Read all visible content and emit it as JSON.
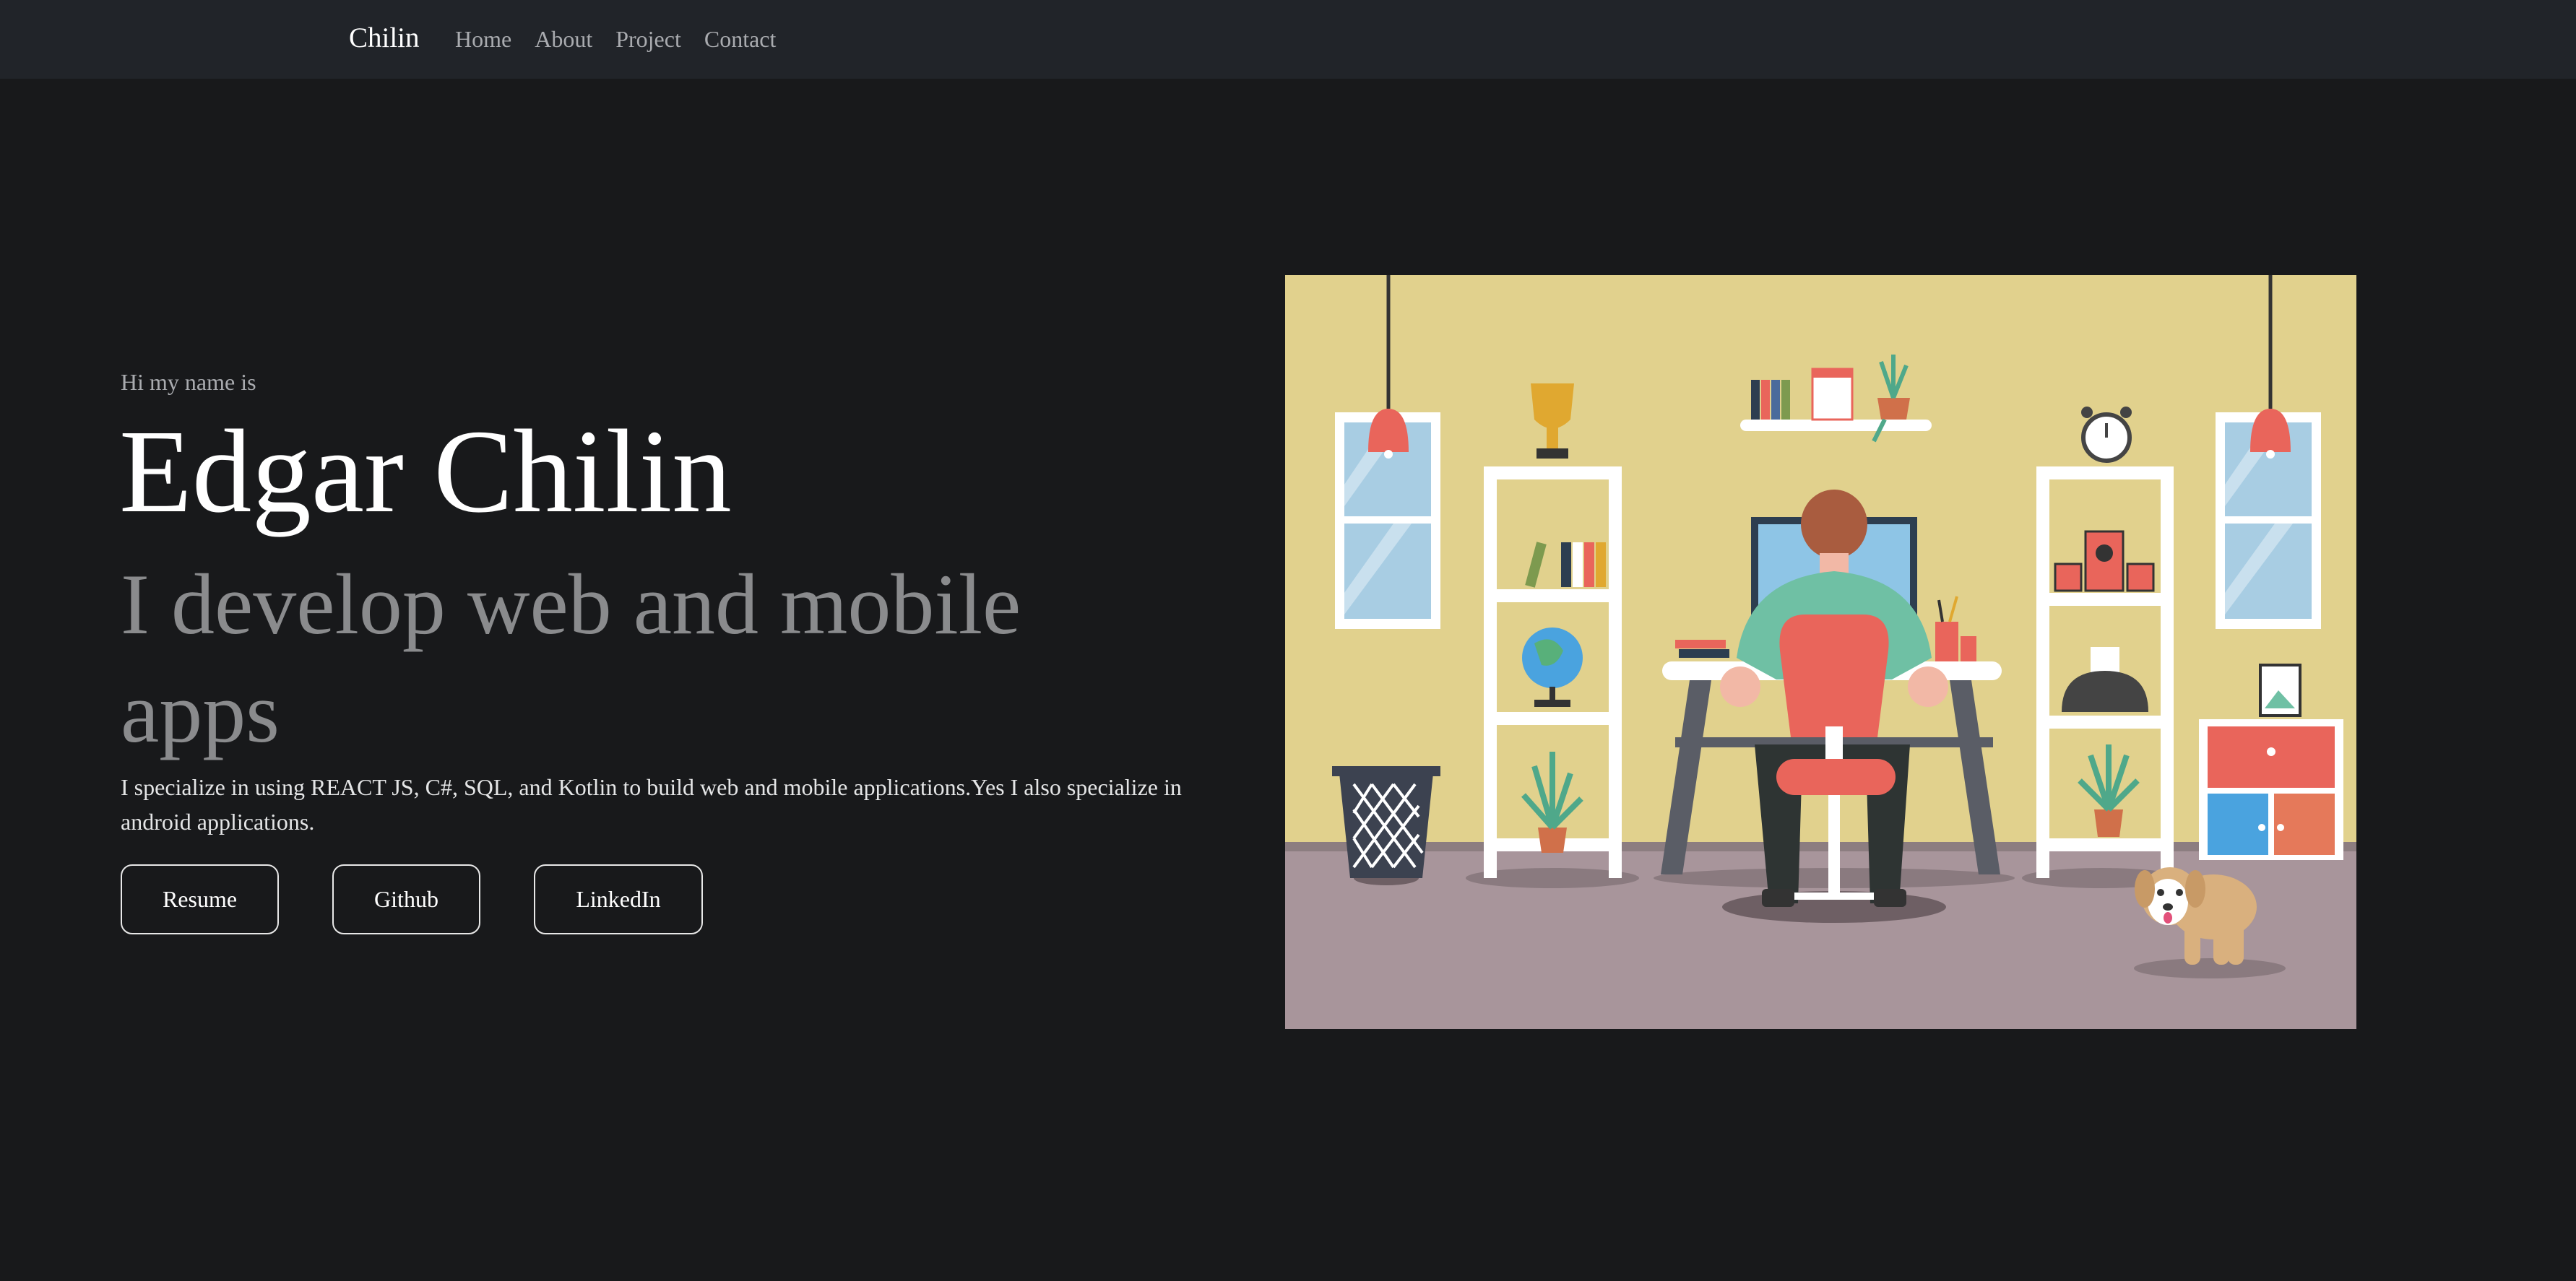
{
  "nav": {
    "brand": "Chilin",
    "links": [
      "Home",
      "About",
      "Project",
      "Contact"
    ]
  },
  "hero": {
    "greeting": "Hi my name is",
    "name": "Edgar Chilin",
    "tagline": "I develop web and mobile apps",
    "description": "I specialize in using REACT JS, C#, SQL, and Kotlin to build web and mobile applications.Yes I also specialize in android applications.",
    "buttons": {
      "resume": "Resume",
      "github": "Github",
      "linkedin": "LinkedIn"
    }
  },
  "colors": {
    "page_bg": "#18191b",
    "navbar_bg": "#212429",
    "wall": "#e1d18d",
    "floor": "#a8959b",
    "accent_red": "#e9655b"
  }
}
